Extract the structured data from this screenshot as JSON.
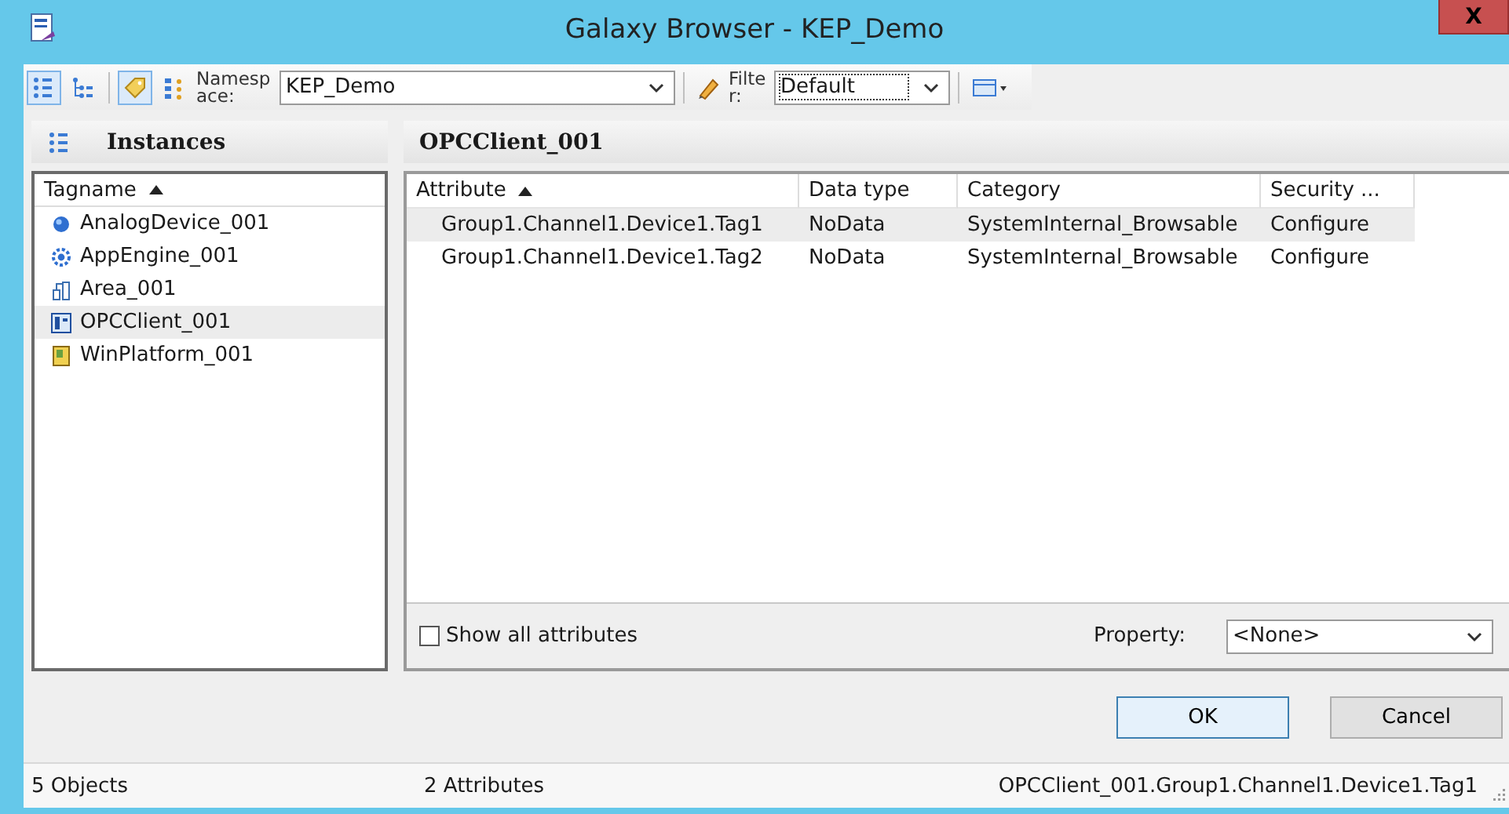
{
  "window": {
    "title": "Galaxy Browser - KEP_Demo",
    "close": "X"
  },
  "toolbar": {
    "buttons": [
      {
        "kind": "list",
        "selected": true
      },
      {
        "kind": "tree",
        "selected": false
      },
      {
        "kind": "tag",
        "selected": true
      },
      {
        "kind": "hierarchy",
        "selected": false
      }
    ],
    "namespace": {
      "label": "Namespace:",
      "value": "KEP_Demo"
    },
    "filter": {
      "label": "Filter:",
      "value": "Default"
    }
  },
  "instances": {
    "title": "Instances",
    "column": "Tagname",
    "items": [
      {
        "kind": "device",
        "name": "AnalogDevice_001",
        "selected": false
      },
      {
        "kind": "engine",
        "name": "AppEngine_001",
        "selected": false
      },
      {
        "kind": "area",
        "name": "Area_001",
        "selected": false
      },
      {
        "kind": "client",
        "name": "OPCClient_001",
        "selected": true
      },
      {
        "kind": "platform",
        "name": "WinPlatform_001",
        "selected": false
      }
    ]
  },
  "attributes": {
    "title": "OPCClient_001",
    "columns": [
      "Attribute",
      "Data type",
      "Category",
      "Security ..."
    ],
    "rows": [
      {
        "cells": [
          "Group1.Channel1.Device1.Tag1",
          "NoData",
          "SystemInternal_Browsable",
          "Configure"
        ],
        "selected": true
      },
      {
        "cells": [
          "Group1.Channel1.Device1.Tag2",
          "NoData",
          "SystemInternal_Browsable",
          "Configure"
        ],
        "selected": false
      }
    ],
    "show_all": {
      "label": "Show all attributes",
      "checked": false
    },
    "property": {
      "label": "Property:",
      "value": "<None>"
    }
  },
  "buttons": [
    {
      "label": "OK",
      "kind": "default"
    },
    {
      "label": "Cancel",
      "kind": "normal"
    }
  ],
  "status_bar": [
    "5 Objects",
    "2 Attributes",
    "OPCClient_001.Group1.Channel1.Device1.Tag1"
  ]
}
